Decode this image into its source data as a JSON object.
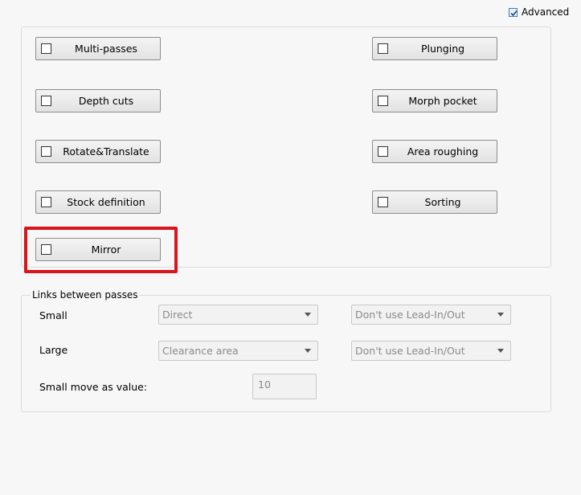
{
  "advanced": {
    "label": "Advanced",
    "checked": true
  },
  "options": {
    "multi_passes": "Multi-passes",
    "depth_cuts": "Depth cuts",
    "rotate_translate": "Rotate&Translate",
    "stock_definition": "Stock definition",
    "mirror": "Mirror",
    "plunging": "Plunging",
    "morph_pocket": "Morph pocket",
    "area_roughing": "Area roughing",
    "sorting": "Sorting"
  },
  "links": {
    "title": "Links between passes",
    "small_label": "Small",
    "small_move": "Direct",
    "small_lead": "Don't use Lead-In/Out",
    "large_label": "Large",
    "large_move": "Clearance area",
    "large_lead": "Don't use Lead-In/Out",
    "small_move_value_label": "Small move as value:",
    "small_move_value": "10"
  },
  "colors": {
    "highlight": "#d9141c",
    "checkbox_accent": "#4a7bb5"
  }
}
